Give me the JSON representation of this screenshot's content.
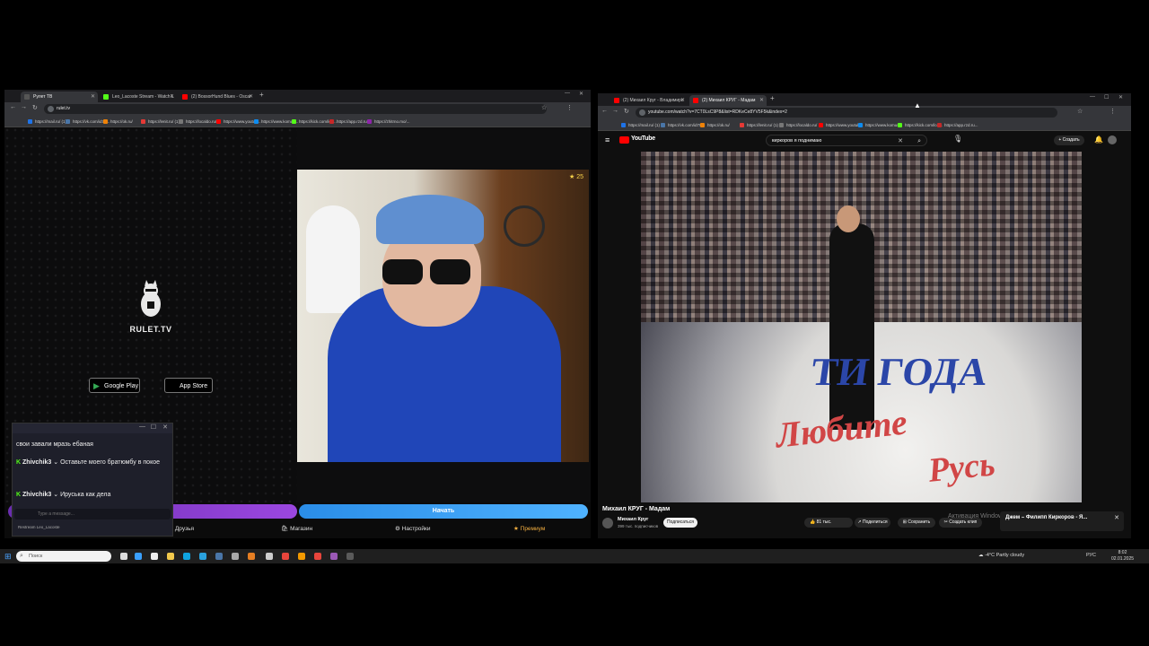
{
  "left_browser": {
    "tabs": [
      {
        "label": "Рулет ТВ",
        "active": true
      },
      {
        "label": "Leo_Lacoste Stream - Watch L",
        "active": false
      },
      {
        "label": "(2) BossorHund Blues - Oscar",
        "active": false
      }
    ],
    "url": "rulet.tv",
    "bookmarks": [
      "https://mail.ru/ (1)",
      "https://vk.com/id70...",
      "https://ok.ru/",
      "https://lenit.ru/ (1)",
      "https://localdo.ru/",
      "https://www.youtub...",
      "https://www.komus...",
      "https://kick.com/lco...",
      "https://app.rzd.ru...",
      "https://zhitrno.mo/..."
    ]
  },
  "rulet": {
    "logo_text": "RULET.TV",
    "google_play_label": "Google Play",
    "app_store_label": "App Store",
    "cam_counter": "25",
    "start_label": "Начать",
    "menu": [
      "Друзья",
      "Магазин",
      "Настройки",
      "Премиум"
    ]
  },
  "chat": {
    "messages": [
      {
        "user": "",
        "text": "свои завали мразь ебаная"
      },
      {
        "user": "Zhivchik3",
        "text": "Оставьте моего братюмбу в покое"
      },
      {
        "user": "Zhivchik3",
        "text": "Ируська как дела"
      }
    ],
    "input_placeholder": "Type a message...",
    "footer_name": "Restream Leo_Lacoste"
  },
  "right_browser": {
    "tabs": [
      {
        "label": "(2) Михаил Круг - Владимирс",
        "active": false
      },
      {
        "label": "(2) Михаил КРУГ - Мадам",
        "active": true
      }
    ],
    "url": "youtube.com/watch?v=7CT0LsC9P8&list=RDKeCe8YV5F5k&index=2",
    "bookmarks": [
      "https://mail.ru/ (1)",
      "https://vk.com/id70...",
      "https://ok.ru/",
      "https://lenit.ru/ (1)",
      "https://localdo.ru/",
      "https://www.youtub...",
      "https://www.komus...",
      "https://kick.com/lco...",
      "https://app.rzd.ru..."
    ]
  },
  "youtube": {
    "logo": "YouTube",
    "search_text": "киркоров я поднимаю",
    "create_label": "Создать",
    "video_title": "Михаил КРУГ - Мадам",
    "channel_name": "Михаил Круг",
    "subscribers": "399 тыс. подписчиков",
    "subscribe_label": "Подписаться",
    "likes": "81 тыс.",
    "share_label": "Поделиться",
    "save_label": "Сохранить",
    "clip_label": "Создать клип",
    "stage_text_1": "ТИ ГОДА",
    "stage_text_2": "Любите",
    "stage_text_3": "Русь",
    "activation_text": "Активация Windows",
    "popup_title": "Джем – Филипп Киркоров - Я..."
  },
  "taskbar": {
    "search_placeholder": "Поиск",
    "weather": "-4°C  Partly cloudy",
    "lang": "РУС",
    "time": "8:02",
    "date": "02.01.2025"
  }
}
